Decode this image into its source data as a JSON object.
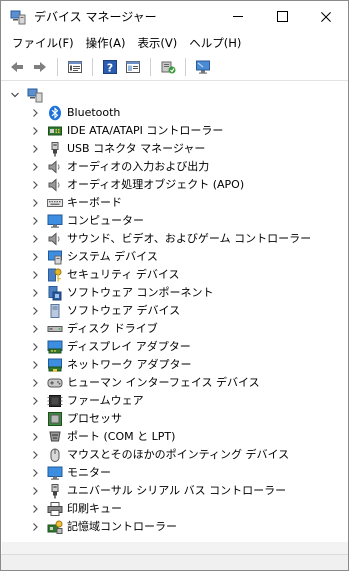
{
  "window": {
    "title": "デバイス マネージャー"
  },
  "menu": [
    "ファイル(F)",
    "操作(A)",
    "表示(V)",
    "ヘルプ(H)"
  ],
  "toolbar": [
    {
      "name": "back-button",
      "icon": "arrow-left"
    },
    {
      "name": "forward-button",
      "icon": "arrow-right"
    },
    {
      "name": "properties-button",
      "icon": "properties"
    },
    {
      "name": "help-button",
      "icon": "help"
    },
    {
      "name": "show-hide-console-tree-button",
      "icon": "console-tree"
    },
    {
      "name": "update-driver-button",
      "icon": "update-driver"
    },
    {
      "name": "scan-hardware-button",
      "icon": "monitor-scan"
    }
  ],
  "root": {
    "label": "",
    "expanded": true,
    "icon": "computer"
  },
  "categories": [
    {
      "label": "Bluetooth",
      "icon": "bluetooth"
    },
    {
      "label": "IDE ATA/ATAPI コントローラー",
      "icon": "ide-controller"
    },
    {
      "label": "USB コネクタ マネージャー",
      "icon": "usb"
    },
    {
      "label": "オーディオの入力および出力",
      "icon": "speaker"
    },
    {
      "label": "オーディオ処理オブジェクト (APO)",
      "icon": "speaker"
    },
    {
      "label": "キーボード",
      "icon": "keyboard"
    },
    {
      "label": "コンピューター",
      "icon": "computer-monitor"
    },
    {
      "label": "サウンド、ビデオ、およびゲーム コントローラー",
      "icon": "speaker"
    },
    {
      "label": "システム デバイス",
      "icon": "system-device"
    },
    {
      "label": "セキュリティ デバイス",
      "icon": "security-key"
    },
    {
      "label": "ソフトウェア コンポーネント",
      "icon": "software-component"
    },
    {
      "label": "ソフトウェア デバイス",
      "icon": "software-device"
    },
    {
      "label": "ディスク ドライブ",
      "icon": "disk-drive"
    },
    {
      "label": "ディスプレイ アダプター",
      "icon": "display-adapter"
    },
    {
      "label": "ネットワーク アダプター",
      "icon": "network-adapter"
    },
    {
      "label": "ヒューマン インターフェイス デバイス",
      "icon": "hid"
    },
    {
      "label": "ファームウェア",
      "icon": "firmware"
    },
    {
      "label": "プロセッサ",
      "icon": "processor"
    },
    {
      "label": "ポート (COM と LPT)",
      "icon": "port"
    },
    {
      "label": "マウスとそのほかのポインティング デバイス",
      "icon": "mouse"
    },
    {
      "label": "モニター",
      "icon": "monitor"
    },
    {
      "label": "ユニバーサル シリアル バス コントローラー",
      "icon": "usb"
    },
    {
      "label": "印刷キュー",
      "icon": "printer"
    },
    {
      "label": "記憶域コントローラー",
      "icon": "storage-controller"
    }
  ]
}
